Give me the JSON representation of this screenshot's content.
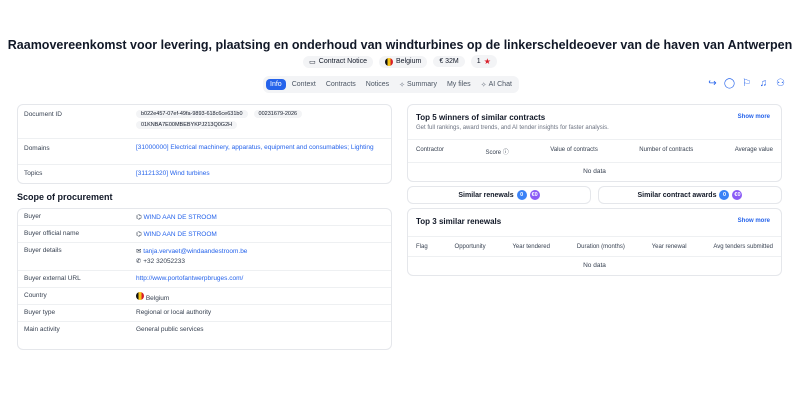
{
  "title": "Raamovereenkomst voor levering, plaatsing en onderhoud van windturbines op de linkerscheldeoever van de haven van Antwerpen",
  "meta": {
    "type": "Contract Notice",
    "country": "Belgium",
    "value": "€ 32M",
    "rating": "1"
  },
  "tabs": [
    {
      "label": "Info"
    },
    {
      "label": "Context"
    },
    {
      "label": "Contracts"
    },
    {
      "label": "Notices"
    },
    {
      "label": "Summary"
    },
    {
      "label": "My files"
    },
    {
      "label": "AI Chat"
    }
  ],
  "info": {
    "document_id_label": "Document ID",
    "document_ids": [
      "b022e457-07ef-49fa-9893-618c6ce631b0",
      "00231679-2026",
      "01KNBA7E00MBEBYKPJ213Q0G2H"
    ],
    "domains_label": "Domains",
    "domains_value": "[31000000] Electrical machinery, apparatus, equipment and consumables; Lighting",
    "topics_label": "Topics",
    "topics_value": "[31121320] Wind turbines"
  },
  "scope": {
    "heading": "Scope of procurement",
    "buyer_label": "Buyer",
    "buyer_value": "WIND AAN DE STROOM",
    "buyer_official_label": "Buyer official name",
    "buyer_official_value": "WIND AAN DE STROOM",
    "buyer_details_label": "Buyer details",
    "email": "tanja.vervaet@windaandestroom.be",
    "phone": "+32 32052233",
    "external_url_label": "Buyer external URL",
    "external_url": "http://www.portofantwerpbruges.com/",
    "country_label": "Country",
    "country_value": "Belgium",
    "buyer_type_label": "Buyer type",
    "buyer_type_value": "Regional or local authority",
    "main_activity_label": "Main activity",
    "main_activity_value": "General public services"
  },
  "winners": {
    "title": "Top 5 winners of similar contracts",
    "subtitle": "Get full rankings, award trends, and AI tender insights for faster analysis.",
    "show_more": "Show more",
    "columns": [
      "Contractor",
      "Score",
      "Value of contracts",
      "Number of contracts",
      "Average value"
    ],
    "empty": "No data"
  },
  "similar": {
    "renewals_label": "Similar renewals",
    "renewals_count": "0",
    "renewals_value": "€0",
    "awards_label": "Similar contract awards",
    "awards_count": "0",
    "awards_value": "€0"
  },
  "renewals": {
    "title": "Top 3 similar renewals",
    "show_more": "Show more",
    "columns": [
      "Flag",
      "Opportunity",
      "Year tendered",
      "Duration (months)",
      "Year renewal",
      "Avg tenders submitted"
    ],
    "empty": "No data"
  },
  "colors": {
    "accent": "#2563eb",
    "star": "#d81e2a"
  }
}
